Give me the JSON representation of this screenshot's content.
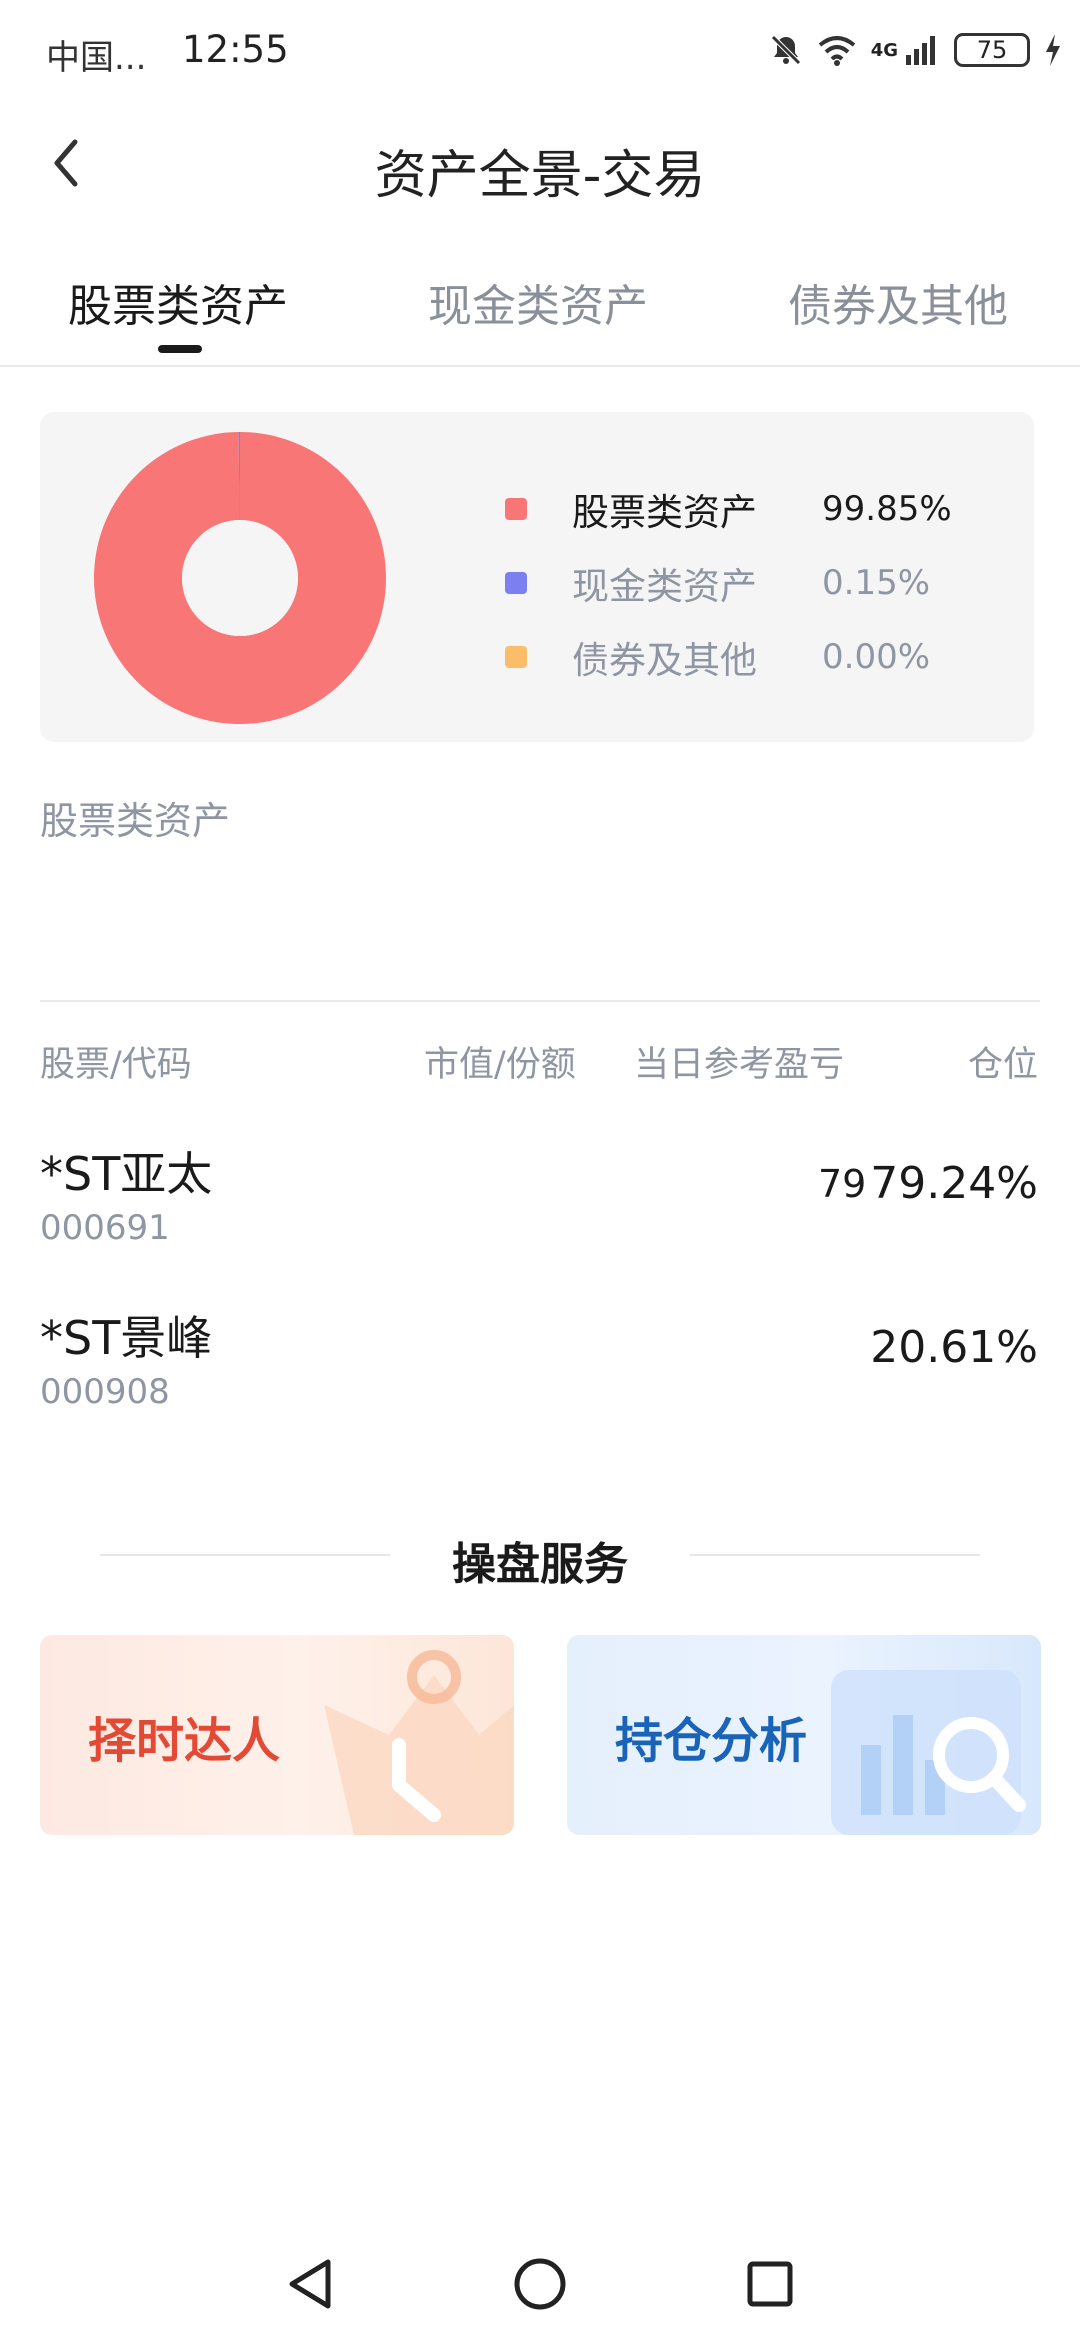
{
  "status_bar": {
    "carrier": "中国...",
    "time": "12:55",
    "network": "4G",
    "battery": "75",
    "icons": [
      "mute-bell-icon",
      "wifi-icon",
      "signal-icon",
      "battery-icon",
      "charging-icon"
    ]
  },
  "header": {
    "back_icon": "chevron-left-icon",
    "title": "资产全景-交易"
  },
  "tabs": [
    {
      "label": "股票类资产",
      "active": true
    },
    {
      "label": "现金类资产",
      "active": false
    },
    {
      "label": "债券及其他",
      "active": false
    }
  ],
  "summary": {
    "legend": [
      {
        "name": "股票类资产",
        "percent": "99.85%",
        "color": "#f87676"
      },
      {
        "name": "现金类资产",
        "percent": "0.15%",
        "color": "#7b7ff0"
      },
      {
        "name": "债券及其他",
        "percent": "0.00%",
        "color": "#fbbd6a"
      }
    ]
  },
  "chart_data": {
    "type": "pie",
    "categories": [
      "股票类资产",
      "现金类资产",
      "债券及其他"
    ],
    "values": [
      99.85,
      0.15,
      0.0
    ],
    "colors": [
      "#f87676",
      "#7b7ff0",
      "#fbbd6a"
    ],
    "donut": true
  },
  "section": {
    "title": "股票类资产"
  },
  "table": {
    "headers": {
      "stock": "股票/代码",
      "value": "市值/份额",
      "pnl": "当日参考盈亏",
      "position": "仓位"
    },
    "rows": [
      {
        "name": "*ST亚太",
        "code": "000691",
        "value": "",
        "pnl": "79",
        "position": "79.24%"
      },
      {
        "name": "*ST景峰",
        "code": "000908",
        "value": "",
        "pnl": "",
        "position": "20.61%"
      }
    ]
  },
  "service": {
    "title": "操盘服务",
    "cards": [
      {
        "label": "择时达人",
        "color": "#e24a35",
        "icon": "timing-clock-icon"
      },
      {
        "label": "持仓分析",
        "color": "#1a64b8",
        "icon": "chart-search-icon"
      }
    ]
  },
  "nav": {
    "icons": [
      "back-triangle-icon",
      "home-circle-icon",
      "recents-square-icon"
    ]
  }
}
